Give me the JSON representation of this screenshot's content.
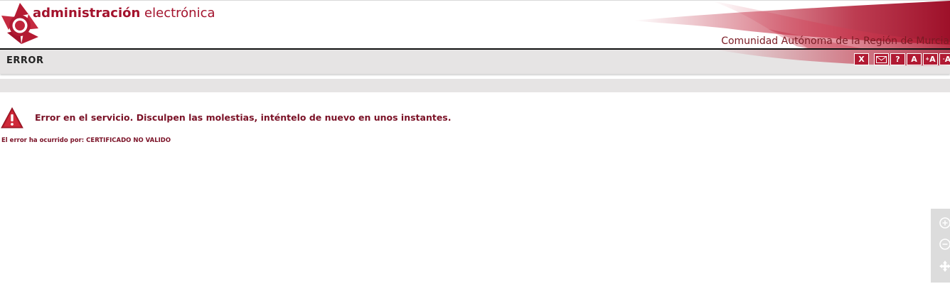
{
  "header": {
    "brand_strong": "administración",
    "brand_light": "electrónica",
    "region": "Comunidad Autónoma de la Región de Murcia"
  },
  "titlebar": {
    "title": "ERROR"
  },
  "toolbar": {
    "close_label": "X",
    "help_label": "?",
    "font_label": "A",
    "font_increase_label": "A",
    "font_increase_sup": "+",
    "font_decrease_label": "A",
    "font_decrease_sup": "-",
    "icons": [
      "close-icon",
      "mail-icon",
      "help-icon",
      "font-normal-icon",
      "font-increase-icon",
      "font-decrease-icon"
    ]
  },
  "error": {
    "message": "Error en el servicio. Disculpen las molestias, inténtelo de nuevo en unos instantes.",
    "detail": "El error ha ocurrido por: CERTIFICADO NO VALIDO",
    "icon": "warning-icon"
  },
  "zoom": {
    "icons": [
      "zoom-in-icon",
      "zoom-out-icon",
      "pan-icon"
    ]
  },
  "colors": {
    "brand": "#a3122c",
    "error_text": "#7a1126",
    "bar_gray": "#e6e4e4",
    "tool_red": "#b11a33"
  }
}
